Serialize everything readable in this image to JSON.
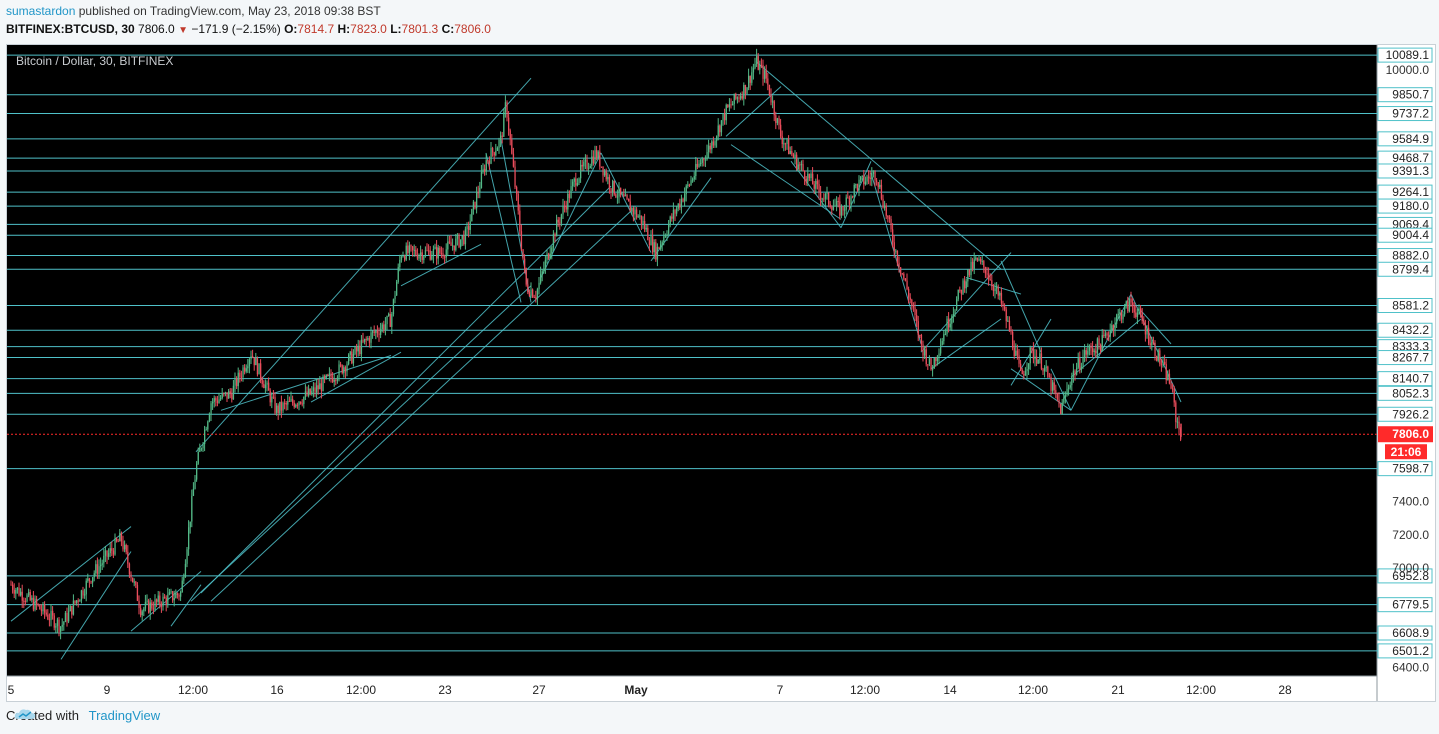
{
  "header": {
    "user": "sumastardon",
    "published": "published on TradingView.com, May 23, 2018 09:38 BST",
    "symbol": "BITFINEX:BTCUSD, 30",
    "last": "7806.0",
    "change": "−171.9 (−2.15%)",
    "o_label": "O:",
    "o": "7814.7",
    "h_label": "H:",
    "h": "7823.0",
    "l_label": "L:",
    "l": "7801.3",
    "c_label": "C:",
    "c": "7806.0"
  },
  "colors": {
    "up": "#53b987",
    "down": "#eb4d5c",
    "lines": "#4fc1c9",
    "bg": "#000000",
    "current": "#ff2a2a",
    "accent": "#2196c8"
  },
  "chart_data": {
    "type": "candlestick",
    "title": "Bitcoin / Dollar, 30, BITFINEX",
    "xlabel": "",
    "ylabel": "",
    "ylim": [
      6350,
      10150
    ],
    "x_ticks": [
      "5",
      "9",
      "12:00",
      "16",
      "12:00",
      "23",
      "27",
      "May",
      "7",
      "12:00",
      "14",
      "12:00",
      "21",
      "12:00",
      "28"
    ],
    "y_ticks": [
      10000.0,
      7400.0,
      7200.0,
      7000.0,
      6400.0
    ],
    "y_tick_labels": [
      "10000.0",
      "7400.0",
      "7200.0",
      "7000.0",
      "6400.0"
    ],
    "horizontal_levels": [
      10089.1,
      9850.7,
      9737.2,
      9584.9,
      9468.7,
      9391.3,
      9264.1,
      9180.0,
      9069.4,
      9004.4,
      8882.0,
      8799.4,
      8581.2,
      8432.2,
      8333.3,
      8267.7,
      8140.7,
      8052.3,
      7926.2,
      7598.7,
      6952.8,
      6779.5,
      6608.9,
      6501.2
    ],
    "horizontal_level_labels": [
      "10089.1",
      "9850.7",
      "9737.2",
      "9584.9",
      "9468.7",
      "9391.3",
      "9264.1",
      "9180.0",
      "9069.4",
      "9004.4",
      "8882.0",
      "8799.4",
      "8581.2",
      "8432.2",
      "8333.3",
      "8267.7",
      "8140.7",
      "8052.3",
      "7926.2",
      "7598.7",
      "6952.8",
      "6779.5",
      "6608.9",
      "6501.2"
    ],
    "current_price": 7806.0,
    "current_price_label": "7806.0",
    "countdown": "21:06",
    "price_path": [
      [
        0.0,
        6900
      ],
      [
        0.05,
        6650
      ],
      [
        0.08,
        6950
      ],
      [
        0.11,
        7180
      ],
      [
        0.13,
        6750
      ],
      [
        0.15,
        6800
      ],
      [
        0.17,
        6850
      ],
      [
        0.185,
        7600
      ],
      [
        0.2,
        8000
      ],
      [
        0.22,
        8050
      ],
      [
        0.24,
        8300
      ],
      [
        0.265,
        7950
      ],
      [
        0.3,
        8050
      ],
      [
        0.33,
        8200
      ],
      [
        0.36,
        8400
      ],
      [
        0.38,
        8500
      ],
      [
        0.39,
        8900
      ],
      [
        0.43,
        8900
      ],
      [
        0.455,
        9000
      ],
      [
        0.475,
        9450
      ],
      [
        0.49,
        9580
      ],
      [
        0.495,
        9800
      ],
      [
        0.505,
        9250
      ],
      [
        0.515,
        8700
      ],
      [
        0.525,
        8650
      ],
      [
        0.545,
        9050
      ],
      [
        0.565,
        9350
      ],
      [
        0.585,
        9500
      ],
      [
        0.6,
        9300
      ],
      [
        0.63,
        9100
      ],
      [
        0.645,
        8900
      ],
      [
        0.66,
        9100
      ],
      [
        0.69,
        9450
      ],
      [
        0.7,
        9550
      ],
      [
        0.715,
        9750
      ],
      [
        0.735,
        9900
      ],
      [
        0.745,
        10050
      ],
      [
        0.755,
        9950
      ],
      [
        0.77,
        9600
      ],
      [
        0.785,
        9450
      ],
      [
        0.81,
        9250
      ],
      [
        0.83,
        9150
      ],
      [
        0.845,
        9300
      ],
      [
        0.865,
        9380
      ],
      [
        0.885,
        8900
      ],
      [
        0.9,
        8600
      ],
      [
        0.91,
        8350
      ],
      [
        0.92,
        8200
      ],
      [
        0.935,
        8450
      ],
      [
        0.955,
        8750
      ],
      [
        0.965,
        8850
      ],
      [
        0.975,
        8800
      ],
      [
        0.99,
        8600
      ],
      [
        1.0,
        8400
      ],
      [
        1.01,
        8150
      ],
      [
        1.02,
        8300
      ],
      [
        1.03,
        8250
      ],
      [
        1.04,
        8100
      ],
      [
        1.05,
        7950
      ],
      [
        1.06,
        8150
      ],
      [
        1.075,
        8300
      ],
      [
        1.09,
        8350
      ],
      [
        1.105,
        8500
      ],
      [
        1.12,
        8600
      ],
      [
        1.13,
        8500
      ],
      [
        1.145,
        8300
      ],
      [
        1.16,
        8100
      ],
      [
        1.165,
        7900
      ],
      [
        1.17,
        7806
      ]
    ],
    "grid": false,
    "legend": "none"
  },
  "footer": {
    "created_with": "Created with",
    "brand": "TradingView"
  }
}
